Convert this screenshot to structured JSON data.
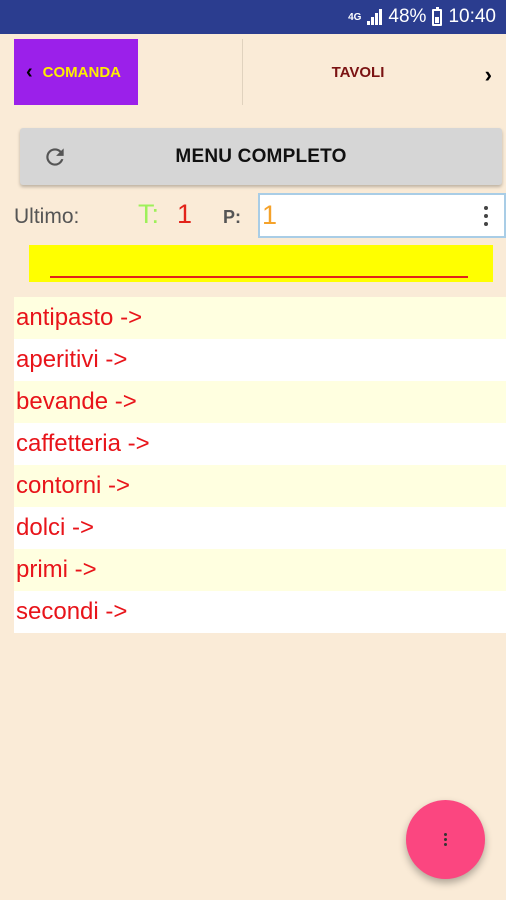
{
  "status_bar": {
    "network": "4G",
    "battery": "48%",
    "time": "10:40"
  },
  "tabs": {
    "comanda": "COMANDA",
    "tavoli": "TAVOLI"
  },
  "menu_button": {
    "label": "MENU COMPLETO",
    "icon": "refresh-icon"
  },
  "info": {
    "ultimo_label": "Ultimo:",
    "t_label": "T:",
    "t_value": "1",
    "p_label": "P:",
    "p_value": "1"
  },
  "categories": [
    "antipasto ->",
    "aperitivi ->",
    "bevande ->",
    "caffetteria ->",
    "contorni ->",
    "dolci ->",
    "primi ->",
    "secondi ->"
  ],
  "colors": {
    "status_bar": "#2b3d8f",
    "background": "#faebd7",
    "comanda_tab": "#9b20ea",
    "comanda_text": "#ffee00",
    "tavoli_text": "#7a1212",
    "category_text": "#e8141a",
    "highlight_bar": "#ffff00",
    "fab": "#fb4680"
  }
}
